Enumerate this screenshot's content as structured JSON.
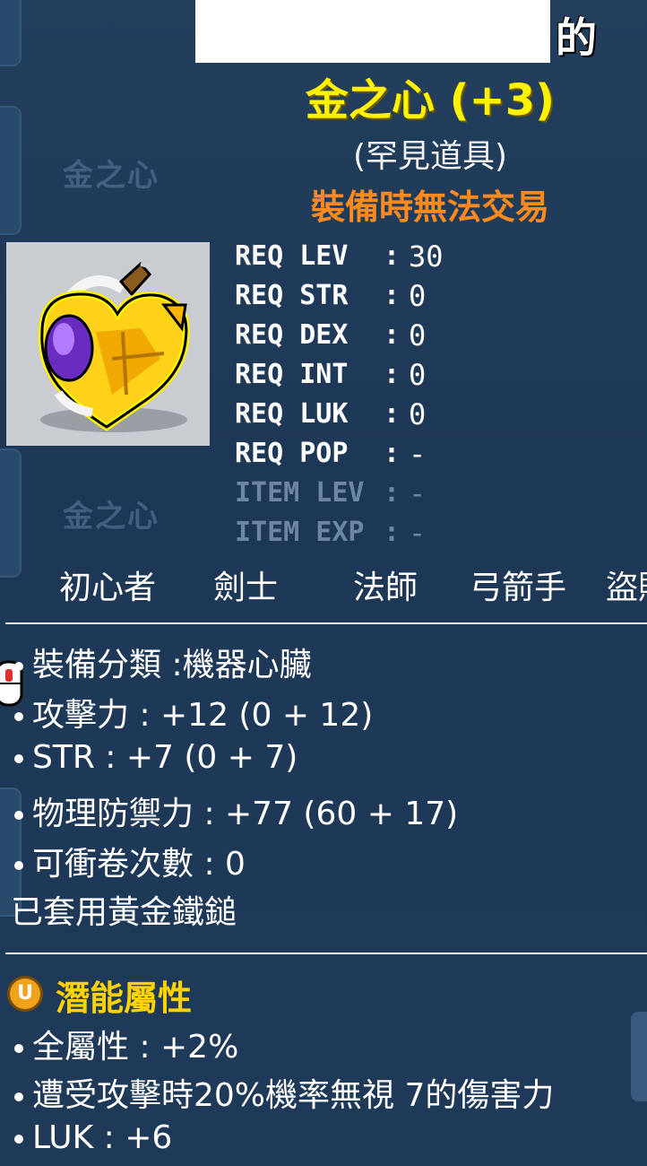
{
  "tooltip": {
    "owner_suffix": "的",
    "item_name": "金之心 (+3)",
    "rarity": "(罕見道具)",
    "trade_note": "裝備時無法交易",
    "background_ghost_text": "金之心",
    "requirements": [
      {
        "label": "REQ LEV",
        "value": "30",
        "dim": false
      },
      {
        "label": "REQ STR",
        "value": "0",
        "dim": false
      },
      {
        "label": "REQ DEX",
        "value": "0",
        "dim": false
      },
      {
        "label": "REQ INT",
        "value": "0",
        "dim": false
      },
      {
        "label": "REQ LUK",
        "value": "0",
        "dim": false
      },
      {
        "label": "REQ POP",
        "value": "-",
        "dim": false
      },
      {
        "label": "ITEM LEV",
        "value": "-",
        "dim": true
      },
      {
        "label": "ITEM EXP",
        "value": "-",
        "dim": true
      }
    ],
    "jobs": [
      "初心者",
      "劍士",
      "法師",
      "弓箭手",
      "盜賊"
    ],
    "stats": [
      "裝備分類 :機器心臟",
      "攻擊力 : +12 (0 + 12)",
      "STR : +7 (0 + 7)",
      "物理防禦力 : +77 (60 + 17)",
      "可衝卷次數 : 0"
    ],
    "set_effect": "已套用黃金鐵鎚",
    "potential": {
      "badge": "U",
      "title": "潛能屬性",
      "lines": [
        "全屬性 : +2%",
        "遭受攻擊時20%機率無視 7的傷害力",
        "LUK : +6"
      ]
    }
  },
  "colors": {
    "background": "#1f3a58",
    "title_yellow": "#fff200",
    "untradeable_orange": "#ff8a1e",
    "potential_gold": "#ffd200",
    "dim_text": "#6f86a2"
  }
}
